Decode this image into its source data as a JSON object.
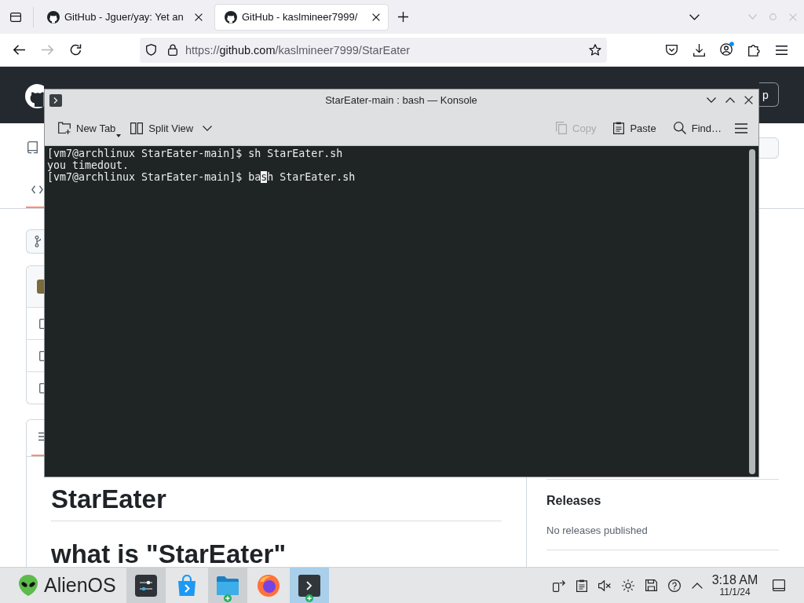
{
  "browser": {
    "tabs": [
      {
        "title": "GitHub - Jguer/yay: Yet an",
        "selected": false
      },
      {
        "title": "GitHub - kaslmineer7999/",
        "selected": true
      }
    ],
    "forward_button": {
      "disabled": true
    },
    "address_bar": {
      "scheme": "https://",
      "host": "github.com",
      "path": "/kaslmineer7999/StarEater"
    },
    "account": {
      "notification": true
    }
  },
  "github_page": {
    "header_button": {
      "label": "p"
    },
    "readme": {
      "title": "StarEater",
      "heading": "what is \"StarEater\""
    },
    "releases": {
      "title": "Releases",
      "text": "No releases published"
    }
  },
  "konsole": {
    "title": "StarEater-main : bash — Konsole",
    "toolbar_left": [
      {
        "kind": "new-tab",
        "label": "New Tab",
        "disabled": false
      },
      {
        "kind": "split-view",
        "label": "Split View",
        "disabled": false
      }
    ],
    "toolbar_right": [
      {
        "kind": "copy",
        "label": "Copy",
        "disabled": true
      },
      {
        "kind": "paste",
        "label": "Paste",
        "disabled": false
      },
      {
        "kind": "find",
        "label": "Find…",
        "disabled": false
      }
    ],
    "terminal": {
      "lines": [
        {
          "text": "[vm7@archlinux StarEater-main]$ sh StarEater.sh"
        },
        {
          "text": "you timedout."
        },
        {
          "text": "[vm7@archlinux StarEater-main]$ ba",
          "cursor": "s",
          "after_cursor": "h StarEater.sh"
        }
      ]
    }
  },
  "taskbar": {
    "launcher": {
      "label": "AlienOS"
    },
    "tasks": [
      {
        "kind": "settings",
        "highlighted": true,
        "selected": false,
        "badge": false
      },
      {
        "kind": "store",
        "highlighted": false,
        "selected": false,
        "badge": false
      },
      {
        "kind": "files",
        "highlighted": true,
        "selected": false,
        "badge": true
      },
      {
        "kind": "browser",
        "highlighted": false,
        "selected": false,
        "badge": false
      },
      {
        "kind": "terminal",
        "highlighted": false,
        "selected": true,
        "badge": true
      }
    ],
    "tray": {
      "volume_muted": true
    },
    "clock": {
      "time": "3:18 AM",
      "date": "11/1/24"
    }
  }
}
